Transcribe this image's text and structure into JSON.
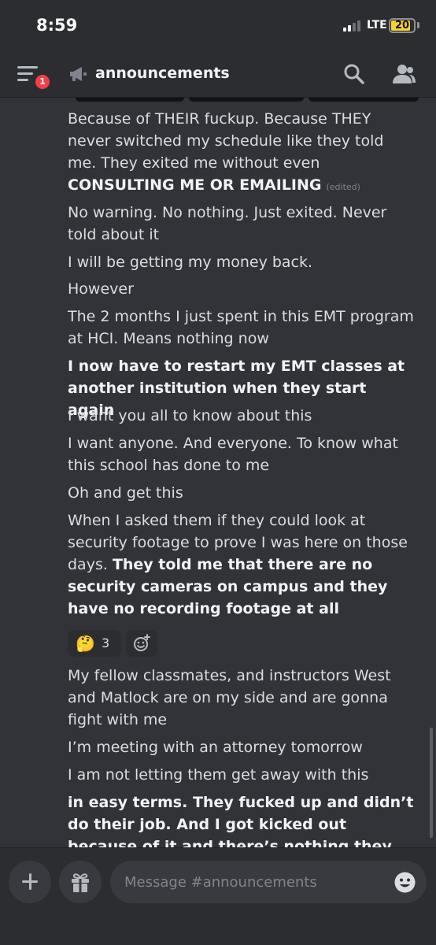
{
  "status_bar": {
    "time": "8:59",
    "network": "LTE",
    "battery": "20"
  },
  "header": {
    "notification_count": "1",
    "channel_name": "announcements"
  },
  "messages": [
    {
      "parts": [
        {
          "text": "Because of THEIR fuckup. Because THEY never switched my schedule like they told me. They exited me without even ",
          "bold": false
        },
        {
          "text": "CONSULTING ME OR EMAILING",
          "bold": true
        }
      ],
      "edited_label": "(edited)"
    },
    {
      "parts": [
        {
          "text": "No warning. No nothing. Just exited. Never told about it",
          "bold": false
        }
      ]
    },
    {
      "parts": [
        {
          "text": "I will be getting my money back.",
          "bold": false
        }
      ]
    },
    {
      "parts": [
        {
          "text": "However",
          "bold": false
        }
      ]
    },
    {
      "parts": [
        {
          "text": "The 2 months I just spent in this EMT program at HCI. Means nothing now",
          "bold": false
        }
      ]
    },
    {
      "parts": [
        {
          "text": "I now have to restart my EMT classes at another institution when they start again",
          "bold": true
        }
      ]
    },
    {
      "parts": [
        {
          "text": "I want you all to know about this",
          "bold": false
        }
      ]
    },
    {
      "parts": [
        {
          "text": "I want anyone. And everyone. To know what this school has done to me",
          "bold": false
        }
      ]
    },
    {
      "parts": [
        {
          "text": "Oh and get this",
          "bold": false
        }
      ]
    },
    {
      "parts": [
        {
          "text": "When I asked them if they could look at security footage to prove I was here on those days. ",
          "bold": false
        },
        {
          "text": "They told me that there are no security cameras on campus and they have no recording footage at all",
          "bold": true
        }
      ]
    },
    {
      "parts": [
        {
          "text": "My fellow classmates, and instructors West and Matlock are on my side and are gonna fight with me",
          "bold": false
        }
      ]
    },
    {
      "parts": [
        {
          "text": "I’m meeting with an attorney tomorrow",
          "bold": false
        }
      ]
    },
    {
      "parts": [
        {
          "text": "I am not letting them get away with this",
          "bold": false
        }
      ]
    },
    {
      "parts": [
        {
          "text": "in easy terms. They fucked up and didn’t do their job. And I got kicked out because of it and there’s nothing they can do about it",
          "bold": true
        }
      ]
    }
  ],
  "reaction": {
    "emoji": "🤔",
    "count": "3",
    "emoji_name": "thinking-face"
  },
  "composer": {
    "placeholder": "Message #announcements"
  },
  "colors": {
    "background": "#313338",
    "header": "#2b2d31",
    "badge": "#f23f43",
    "text": "#dbdee1"
  }
}
